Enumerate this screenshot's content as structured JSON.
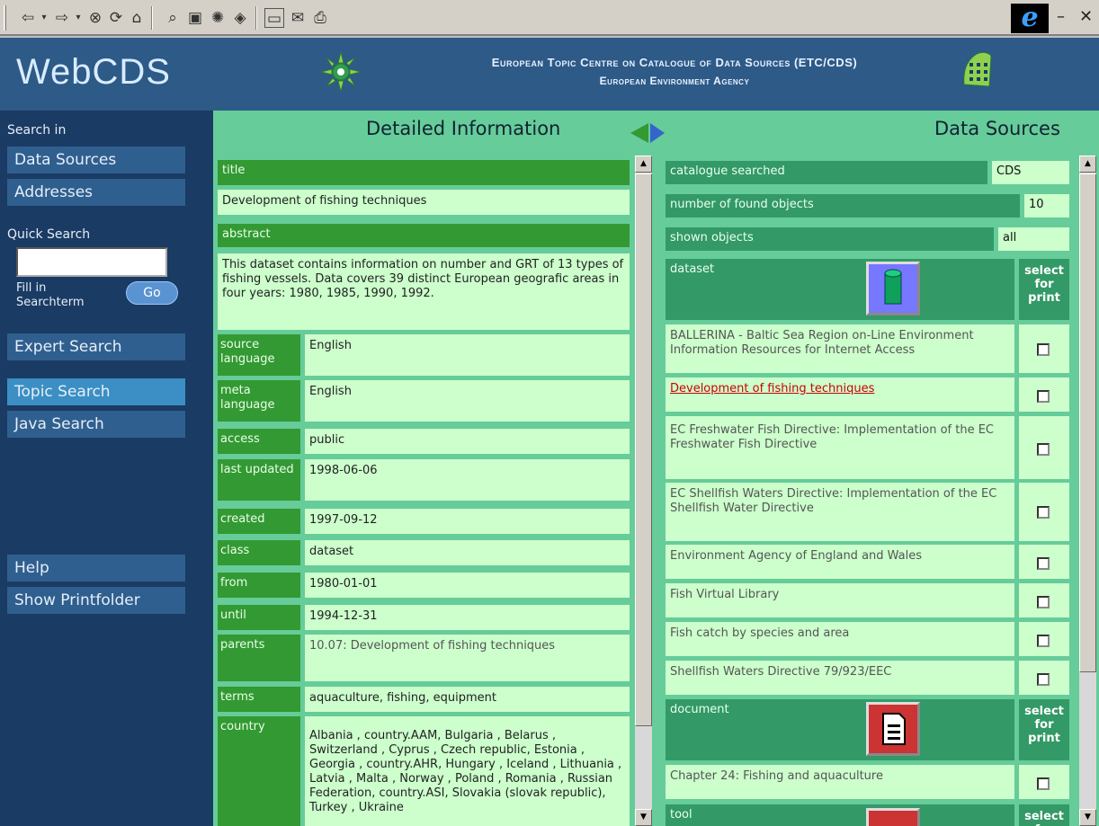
{
  "header": {
    "logo": "WebCDS",
    "org_line1": "European Topic Centre on Catalogue of Data Sources (ETC/CDS)",
    "org_line2": "European Environment Agency"
  },
  "sidebar": {
    "search_in_label": "Search in",
    "data_sources": "Data Sources",
    "addresses": "Addresses",
    "quick_search_label": "Quick Search",
    "quick_search_value": "",
    "fill_label": "Fill in Searchterm",
    "go": "Go",
    "expert_search": "Expert Search",
    "topic_search": "Topic Search",
    "java_search": "Java Search",
    "help": "Help",
    "show_printfolder": "Show Printfolder"
  },
  "detail": {
    "panel_title": "Detailed Information",
    "title_label": "title",
    "title_value": "Development of fishing techniques",
    "abstract_label": "abstract",
    "abstract_value": "This dataset contains information on number and GRT of 13 types of fishing vessels. Data covers 39 distinct European geografic areas in four years: 1980, 1985, 1990, 1992.",
    "fields": [
      {
        "label": "source language",
        "value": "English"
      },
      {
        "label": "meta language",
        "value": "English"
      },
      {
        "label": "access",
        "value": "public"
      },
      {
        "label": "last updated",
        "value": "1998-06-06"
      },
      {
        "label": "created",
        "value": "1997-09-12"
      },
      {
        "label": "class",
        "value": "dataset"
      },
      {
        "label": "from",
        "value": "1980-01-01"
      },
      {
        "label": "until",
        "value": "1994-12-31"
      },
      {
        "label": "parents",
        "value": "10.07: Development of fishing techniques"
      },
      {
        "label": "terms",
        "value": "aquaculture, fishing, equipment"
      },
      {
        "label": "country",
        "value": "Albania , country.AAM, Bulgaria , Belarus , Switzerland , Cyprus , Czech republic, Estonia , Georgia , country.AHR, Hungary , Iceland , Lithuania , Latvia , Malta , Norway , Poland , Romania , Russian Federation, country.ASI, Slovakia (slovak republic), Turkey , Ukraine"
      }
    ]
  },
  "results": {
    "panel_title": "Data Sources",
    "catalogue_label": "catalogue searched",
    "catalogue_value": "CDS",
    "found_label": "number of found objects",
    "found_value": "10",
    "shown_label": "shown objects",
    "shown_value": "all",
    "select_for_print": "select for print",
    "groups": [
      {
        "name": "dataset",
        "icon": "cylinder-icon",
        "items": [
          "BALLERINA - Baltic Sea Region on-Line Environment Information Resources for Internet Access",
          "Development of fishing techniques",
          "EC Freshwater Fish Directive: Implementation of the EC Freshwater Fish Directive",
          "EC Shellfish Waters Directive: Implementation of the EC Shellfish Water Directive",
          "Environment Agency of England and Wales",
          "Fish Virtual Library",
          "Fish catch by species and area",
          "Shellfish Waters Directive 79/923/EEC"
        ]
      },
      {
        "name": "document",
        "icon": "document-icon",
        "items": [
          "Chapter 24: Fishing and aquaculture"
        ]
      },
      {
        "name": "tool",
        "icon": "tool-icon",
        "items": []
      }
    ]
  },
  "colors": {
    "header_bg": "#2d5a87",
    "sidebar_bg": "#1a3b63",
    "main_bg": "#66cc99",
    "label_green": "#339933",
    "cell_bg": "#ccffcc",
    "selected_link": "#cc0000"
  }
}
